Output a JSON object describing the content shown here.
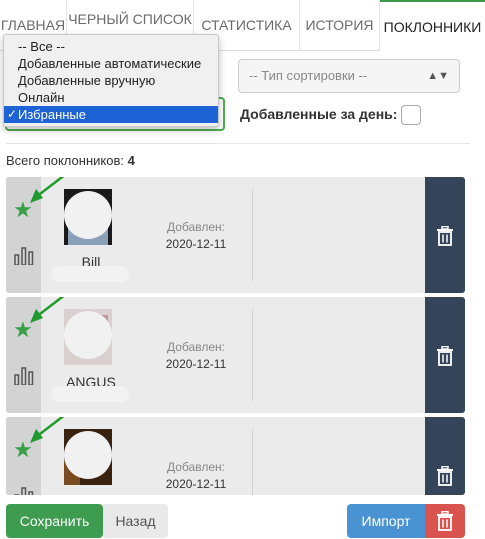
{
  "tabs": [
    {
      "label": "ГЛАВНАЯ",
      "active": false
    },
    {
      "label": "ЧЕРНЫЙ СПИСОК",
      "active": false
    },
    {
      "label": "СТАТИСТИКА",
      "active": false
    },
    {
      "label": "ИСТОРИЯ",
      "active": false
    },
    {
      "label": "ПОКЛОННИКИ",
      "active": true
    }
  ],
  "filters": {
    "sort_placeholder": "-- Тип сортировки --",
    "filter_options": [
      "-- Все --",
      "Добавленные автоматические",
      "Добавленные вручную",
      "Онлайн",
      "Избранные"
    ],
    "filter_selected": "Избранные",
    "day_label": "Добавленные за день:"
  },
  "total": {
    "label": "Всего поклонников:",
    "count": "4"
  },
  "cards": [
    {
      "name": "Bill",
      "added_label": "Добавлен:",
      "date": "2020-12-11",
      "favorite": true
    },
    {
      "name": "ANGUS",
      "added_label": "Добавлен:",
      "date": "2020-12-11",
      "favorite": true
    },
    {
      "name": "",
      "added_label": "Добавлен:",
      "date": "2020-12-11",
      "favorite": true
    }
  ],
  "footer": {
    "save": "Сохранить",
    "back": "Назад",
    "import": "Импорт"
  },
  "colors": {
    "accent_green": "#3aa14a",
    "dark_column": "#344459",
    "danger": "#d9534f",
    "primary": "#4a93d2"
  }
}
